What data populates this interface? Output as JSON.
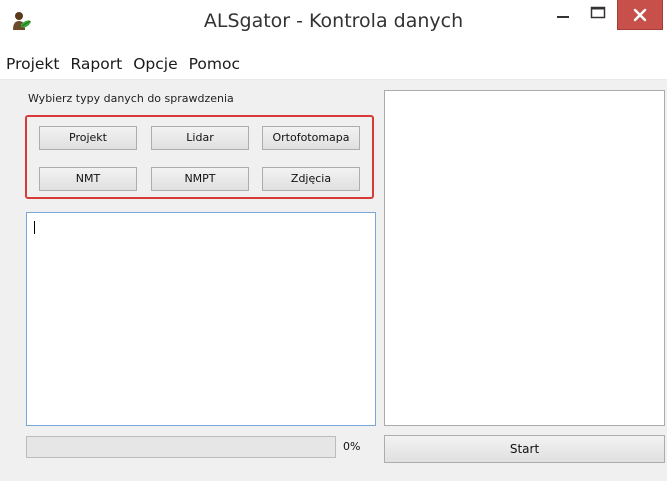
{
  "window": {
    "title": "ALSgator - Kontrola danych",
    "close_color": "#c7504a"
  },
  "menu": {
    "items": [
      "Projekt",
      "Raport",
      "Opcje",
      "Pomoc"
    ]
  },
  "data_types": {
    "label": "Wybierz typy danych do sprawdzenia",
    "highlight_color": "#d83a3a",
    "buttons": [
      "Projekt",
      "Lidar",
      "Ortofotomapa",
      "NMT",
      "NMPT",
      "Zdjęcia"
    ]
  },
  "log": {
    "value": ""
  },
  "progress": {
    "value": 0,
    "label": "0%",
    "fill_color": "#06b025"
  },
  "actions": {
    "start_label": "Start"
  },
  "icons": {
    "app": "user-leaf-icon",
    "minimize": "minimize-icon",
    "maximize": "maximize-icon",
    "close": "close-icon"
  }
}
